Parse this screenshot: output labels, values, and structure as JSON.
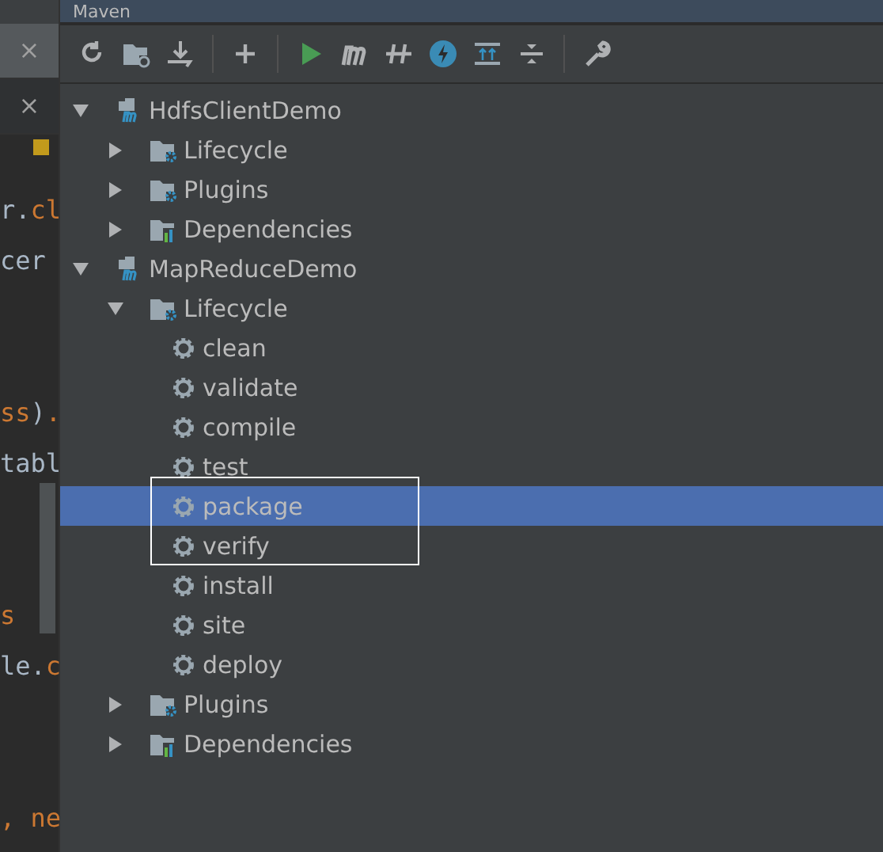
{
  "editor": {
    "tabs": [
      {
        "close": "×",
        "selected": true
      },
      {
        "close": "×",
        "selected": false
      }
    ],
    "lines": [
      [
        {
          "text": "r.",
          "kind": "plain"
        },
        {
          "text": "cl",
          "kind": "keyword"
        }
      ],
      [
        {
          "text": "cer",
          "kind": "plain"
        }
      ],
      [
        {
          "text": "ss",
          "kind": "keyword"
        },
        {
          "text": ")",
          "kind": "plain"
        },
        {
          "text": ".",
          "kind": "keyword"
        }
      ],
      [
        {
          "text": "tabl",
          "kind": "plain"
        }
      ],
      [
        {
          "text": "s",
          "kind": "keyword"
        }
      ],
      [
        {
          "text": "le.",
          "kind": "plain"
        },
        {
          "text": "c",
          "kind": "keyword"
        }
      ],
      [
        {
          "text": ",",
          "kind": "keyword"
        },
        {
          "text": " ne",
          "kind": "keyword"
        }
      ]
    ]
  },
  "panel": {
    "title": "Maven"
  },
  "toolbar": [
    {
      "kind": "reload"
    },
    {
      "kind": "folder"
    },
    {
      "kind": "download"
    },
    {
      "kind": "sep"
    },
    {
      "kind": "plus"
    },
    {
      "kind": "sep"
    },
    {
      "kind": "run"
    },
    {
      "kind": "m"
    },
    {
      "kind": "skip"
    },
    {
      "kind": "bolt"
    },
    {
      "kind": "expand"
    },
    {
      "kind": "collapse"
    },
    {
      "kind": "sep"
    },
    {
      "kind": "wrench"
    }
  ],
  "tree": [
    {
      "label": "HdfsClientDemo",
      "kind": "project",
      "expanded": true,
      "selected": false,
      "children": [
        {
          "label": "Lifecycle",
          "kind": "lifecycle",
          "expanded": false,
          "selected": false
        },
        {
          "label": "Plugins",
          "kind": "plugins",
          "expanded": false,
          "selected": false
        },
        {
          "label": "Dependencies",
          "kind": "dependencies",
          "expanded": false,
          "selected": false
        }
      ]
    },
    {
      "label": "MapReduceDemo",
      "kind": "project",
      "expanded": true,
      "selected": false,
      "children": [
        {
          "label": "Lifecycle",
          "kind": "lifecycle",
          "expanded": true,
          "selected": false,
          "children": [
            {
              "label": "clean",
              "kind": "goal",
              "selected": false
            },
            {
              "label": "validate",
              "kind": "goal",
              "selected": false
            },
            {
              "label": "compile",
              "kind": "goal",
              "selected": false
            },
            {
              "label": "test",
              "kind": "goal",
              "selected": false
            },
            {
              "label": "package",
              "kind": "goal",
              "selected": true
            },
            {
              "label": "verify",
              "kind": "goal",
              "selected": false
            },
            {
              "label": "install",
              "kind": "goal",
              "selected": false
            },
            {
              "label": "site",
              "kind": "goal",
              "selected": false
            },
            {
              "label": "deploy",
              "kind": "goal",
              "selected": false
            }
          ]
        },
        {
          "label": "Plugins",
          "kind": "plugins",
          "expanded": false,
          "selected": false
        },
        {
          "label": "Dependencies",
          "kind": "dependencies",
          "expanded": false,
          "selected": false
        }
      ]
    }
  ]
}
